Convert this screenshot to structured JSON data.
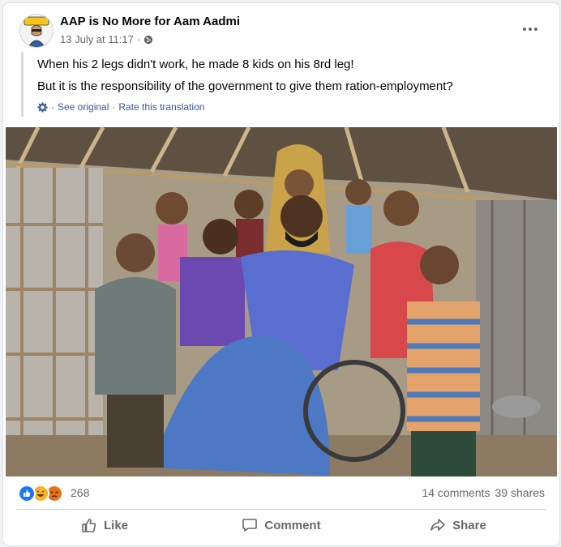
{
  "post": {
    "page_name": "AAP is No More for Aam Aadmi",
    "avatar_label": "भरोसा",
    "date": "13 July at 11:17",
    "separator": "·",
    "privacy_icon": "globe-icon"
  },
  "content": {
    "line1": "When his 2 legs didn't work, he made 8 kids on his 8rd leg!",
    "line2": "But it is the responsibility of the government to give them ration-employment?",
    "see_original": "See original",
    "translation_sep": "·",
    "rate_translation": "Rate this translation",
    "translation_icon": "gear-icon"
  },
  "stats": {
    "reaction_icons": [
      "like-icon",
      "haha-icon",
      "angry-icon"
    ],
    "reaction_count": "268",
    "comments": "14 comments",
    "shares": "39 shares"
  },
  "actions": {
    "like": "Like",
    "comment": "Comment",
    "share": "Share"
  },
  "colors": {
    "link": "#385898",
    "secondary_text": "#65676b",
    "like_blue": "#1877f2",
    "haha_yellow": "#f7b125",
    "angry_orange": "#e9710f"
  }
}
